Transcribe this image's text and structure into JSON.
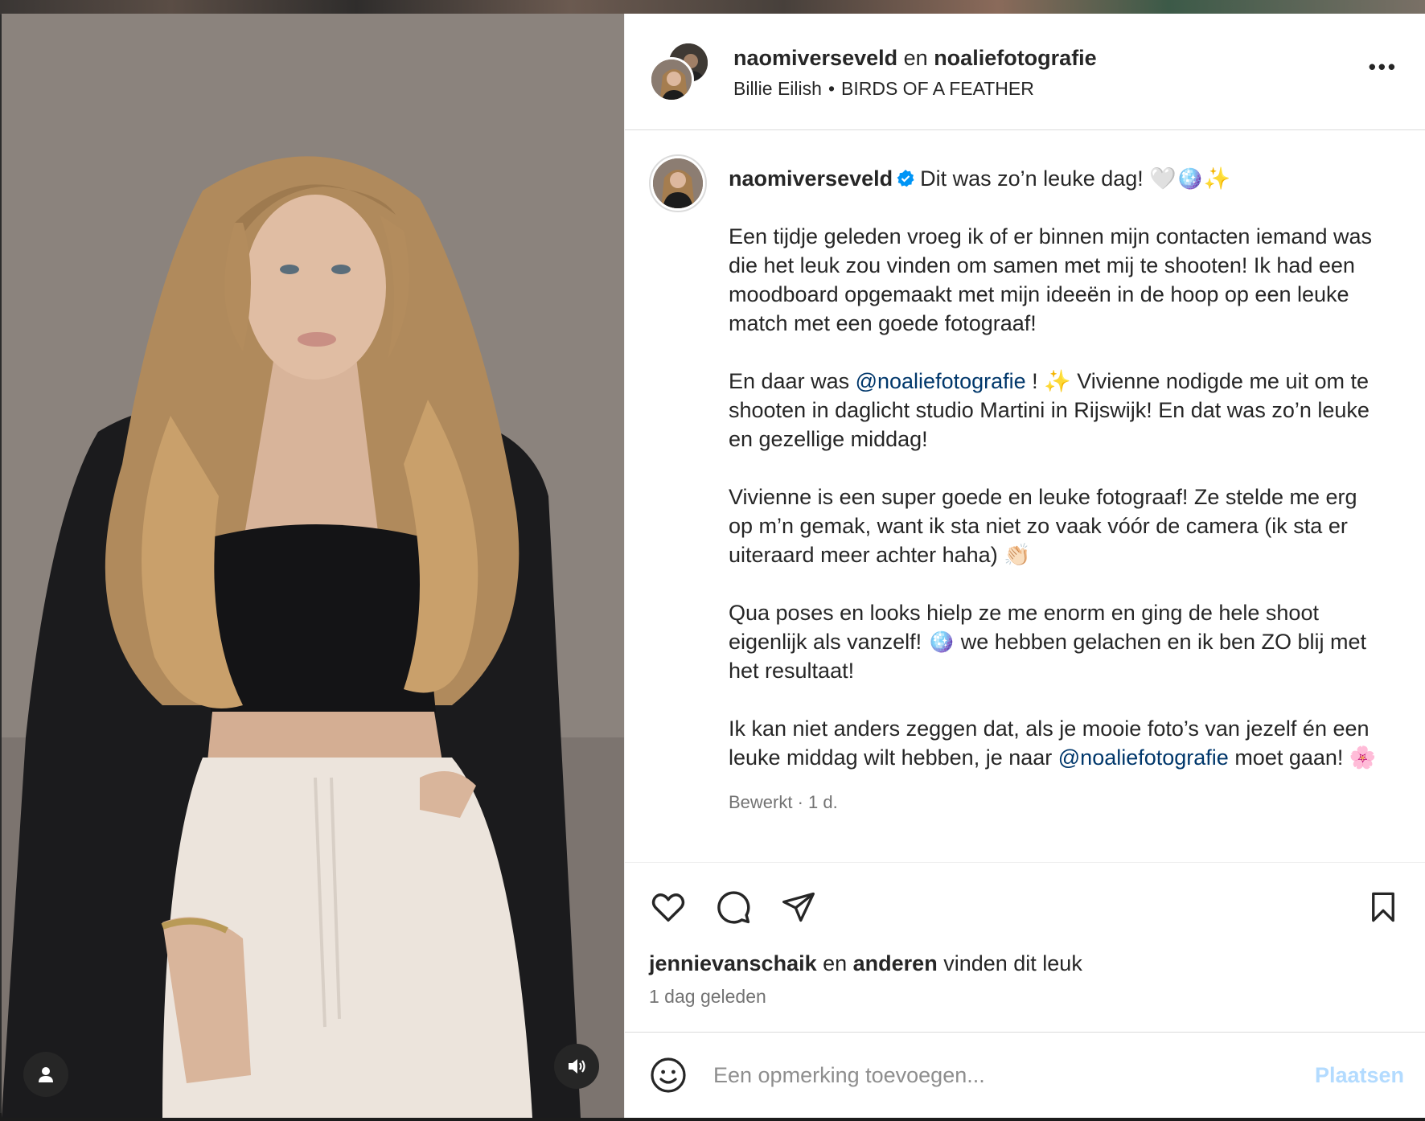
{
  "header": {
    "user1": "naomiverseveld",
    "connector": "en",
    "user2": "noaliefotografie",
    "artist": "Billie Eilish",
    "separator": "•",
    "song": "BIRDS OF A FEATHER",
    "more_label": "•••"
  },
  "caption": {
    "username": "naomiverseveld",
    "headline": "Dit was zo’n leuke dag! 🤍🪩✨",
    "p1": "Een tijdje geleden vroeg ik of er binnen mijn contacten iemand was die het leuk zou vinden om samen met mij te shooten! Ik had een moodboard opgemaakt met mijn ideeën in de hoop op een leuke match met een goede fotograaf!",
    "p2_before": "En daar was ",
    "p2_mention": "@noaliefotografie",
    "p2_after": " ! ✨ Vivienne nodigde me uit om te shooten in daglicht studio Martini in Rijswijk! En dat was zo’n leuke en gezellige middag!",
    "p3": "Vivienne is een super goede en leuke fotograaf! Ze stelde me erg op m’n gemak, want ik sta niet zo vaak vóór de camera (ik sta er uiteraard meer achter haha) 👏🏻",
    "p4": "Qua poses en looks hielp ze me enorm en ging de hele shoot eigenlijk als vanzelf! 🪩 we hebben gelachen en ik ben ZO blij met het resultaat!",
    "p5_before": "Ik kan niet anders zeggen dat, als je mooie foto’s van jezelf én een leuke middag wilt hebben, je naar ",
    "p5_mention": "@noaliefotografie",
    "p5_after": " moet gaan! 🌸",
    "meta": "Bewerkt · 1 d."
  },
  "likes": {
    "user": "jennievanschaik",
    "connector": " en ",
    "others": "anderen",
    "suffix": " vinden dit leuk"
  },
  "time_ago": "1 dag geleden",
  "comment": {
    "placeholder": "Een opmerking toevoegen...",
    "post_label": "Plaatsen"
  },
  "colors": {
    "mention": "#00376b",
    "verified": "#0095f6",
    "post_disabled": "#b3dbff"
  }
}
